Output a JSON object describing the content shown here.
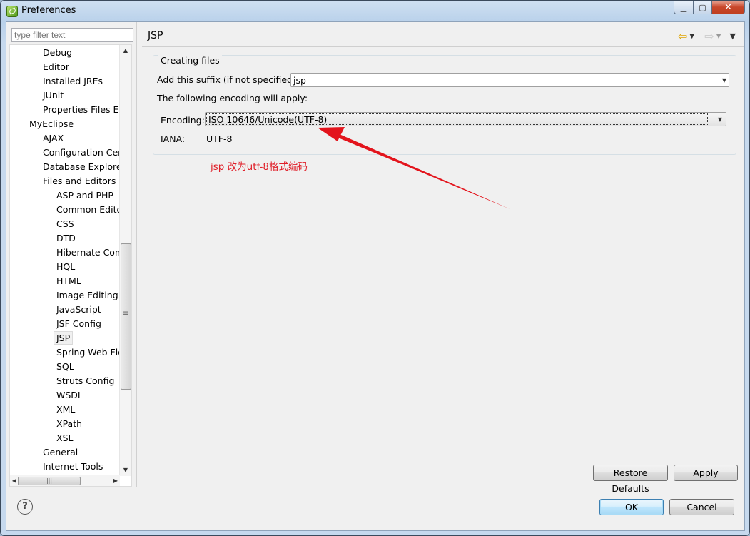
{
  "window": {
    "title": "Preferences"
  },
  "filter": {
    "placeholder": "type filter text"
  },
  "tree": {
    "items": [
      {
        "label": "Debug",
        "level": 2
      },
      {
        "label": "Editor",
        "level": 2
      },
      {
        "label": "Installed JREs",
        "level": 2
      },
      {
        "label": "JUnit",
        "level": 2
      },
      {
        "label": "Properties Files Ed",
        "level": 2
      },
      {
        "label": "MyEclipse",
        "level": 1
      },
      {
        "label": "AJAX",
        "level": 2
      },
      {
        "label": "Configuration Cen",
        "level": 2
      },
      {
        "label": "Database Explorer",
        "level": 2
      },
      {
        "label": "Files and Editors",
        "level": 2
      },
      {
        "label": "ASP and PHP",
        "level": 3
      },
      {
        "label": "Common Edito",
        "level": 3
      },
      {
        "label": "CSS",
        "level": 3
      },
      {
        "label": "DTD",
        "level": 3
      },
      {
        "label": "Hibernate Conf",
        "level": 3
      },
      {
        "label": "HQL",
        "level": 3
      },
      {
        "label": "HTML",
        "level": 3
      },
      {
        "label": "Image Editing",
        "level": 3
      },
      {
        "label": "JavaScript",
        "level": 3
      },
      {
        "label": "JSF Config",
        "level": 3
      },
      {
        "label": "JSP",
        "level": 3,
        "selected": true
      },
      {
        "label": "Spring Web Flo",
        "level": 3
      },
      {
        "label": "SQL",
        "level": 3
      },
      {
        "label": "Struts Config",
        "level": 3
      },
      {
        "label": "WSDL",
        "level": 3
      },
      {
        "label": "XML",
        "level": 3
      },
      {
        "label": "XPath",
        "level": 3
      },
      {
        "label": "XSL",
        "level": 3
      },
      {
        "label": "General",
        "level": 2
      },
      {
        "label": "Internet Tools",
        "level": 2
      }
    ]
  },
  "page": {
    "title": "JSP",
    "group_label": "Creating files",
    "suffix_label": "Add this suffix (if not specified):",
    "suffix_value": "jsp",
    "encoding_note": "The following encoding will apply:",
    "encoding_label": "Encoding:",
    "encoding_value": "ISO 10646/Unicode(UTF-8)",
    "iana_label": "IANA:",
    "iana_value": "UTF-8",
    "annotation": "jsp 改为utf-8格式编码",
    "annotation_color": "#e0202a"
  },
  "buttons": {
    "restore_defaults": "Restore Defaults",
    "apply": "Apply",
    "ok": "OK",
    "cancel": "Cancel"
  },
  "icons": {
    "back": "back-arrow-icon",
    "forward": "forward-arrow-icon",
    "help": "help-icon"
  }
}
